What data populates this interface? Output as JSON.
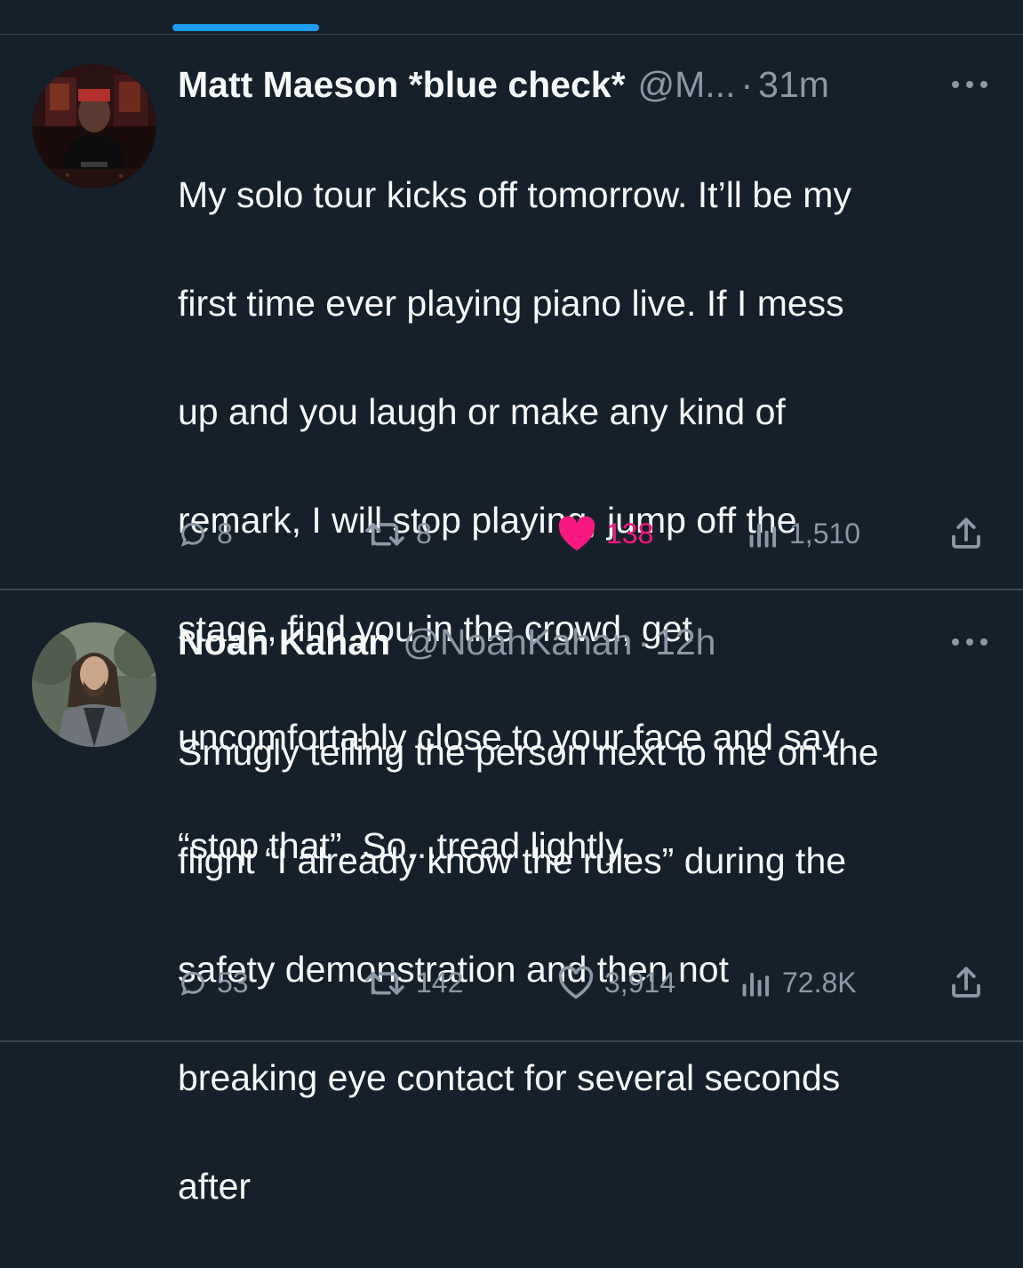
{
  "colors": {
    "background": "#15202b",
    "text": "#f7f9f9",
    "muted": "#8b98a5",
    "accent": "#1d9bf0",
    "like": "#f91880",
    "divider": "#38444d"
  },
  "tweets": [
    {
      "author": "Matt Maeson *blue check*",
      "handle": "@M...",
      "separator": "·",
      "time": "31m",
      "lines": [
        "My solo tour kicks off tomorrow. It’ll be my",
        "first time ever playing piano live. If I mess",
        "up and you laugh or make any kind of",
        "remark, I will stop playing, jump off the",
        "stage, find you in the crowd, get",
        "uncomfortably close to your face and say",
        "“stop that”. So...tread lightly."
      ],
      "replies": "8",
      "retweets": "8",
      "likes": "138",
      "liked": true,
      "views": "1,510"
    },
    {
      "author": "Noah Kahan",
      "handle": "@NoahKahan",
      "separator": "·",
      "time": "12h",
      "lines": [
        "Smugly telling the person next to me on the",
        "flight “I already know the rules” during the",
        "safety demonstration and then not",
        "breaking eye contact for several seconds",
        "after"
      ],
      "replies": "53",
      "retweets": "142",
      "likes": "3,914",
      "liked": false,
      "views": "72.8K"
    }
  ],
  "icons": {
    "reply": "reply-icon",
    "retweet": "retweet-icon",
    "like": "heart-icon",
    "views": "views-icon",
    "share": "share-icon",
    "more": "more-icon"
  }
}
